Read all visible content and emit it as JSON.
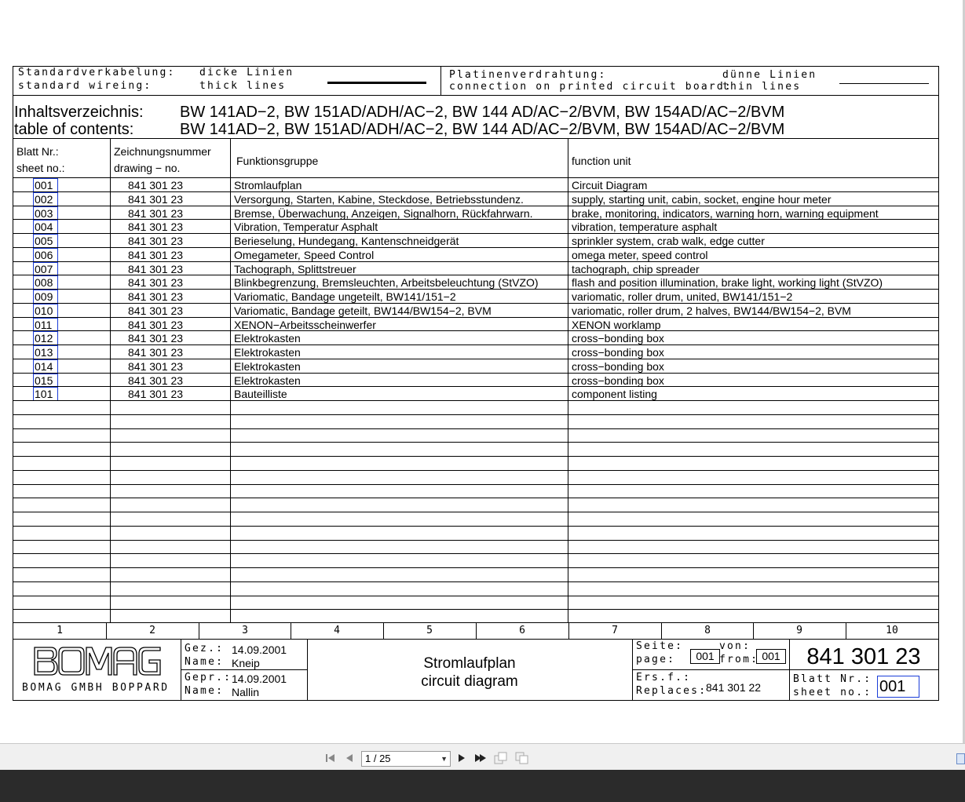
{
  "legend": {
    "std_de": "Standardverkabelung:",
    "std_en": "standard wireing:",
    "thick_de": "dicke Linien",
    "thick_en": "thick lines",
    "pcb_de": "Platinenverdrahtung:",
    "pcb_en": "connection on printed circuit board:",
    "thin_de": "dünne Linien",
    "thin_en": "thin lines"
  },
  "toc": {
    "label_de": "Inhaltsverzeichnis:",
    "label_en": "table of contents:",
    "models_de": "BW 141AD−2, BW 151AD/ADH/AC−2, BW 144 AD/AC−2/BVM, BW 154AD/AC−2/BVM",
    "models_en": "BW 141AD−2, BW 151AD/ADH/AC−2, BW 144 AD/AC−2/BVM, BW 154AD/AC−2/BVM"
  },
  "table": {
    "headers": {
      "sheet_de": "Blatt Nr.:",
      "sheet_en": "sheet no.:",
      "drawing_de": "Zeichnungsnummer",
      "drawing_en": "drawing − no.",
      "func_de": "Funktionsgruppe",
      "func_en": "function unit"
    },
    "rows": [
      {
        "sheet": "001",
        "drawing": "841 301 23",
        "de": "Stromlaufplan",
        "en": "Circuit Diagram"
      },
      {
        "sheet": "002",
        "drawing": "841 301 23",
        "de": "Versorgung, Starten, Kabine, Steckdose, Betriebsstundenz.",
        "en": "supply, starting unit, cabin, socket, engine hour meter"
      },
      {
        "sheet": "003",
        "drawing": "841 301 23",
        "de": "Bremse, Überwachung, Anzeigen, Signalhorn, Rückfahrwarn.",
        "en": "brake, monitoring, indicators, warning horn, warning equipment"
      },
      {
        "sheet": "004",
        "drawing": "841 301 23",
        "de": "Vibration, Temperatur Asphalt",
        "en": "vibration, temperature asphalt"
      },
      {
        "sheet": "005",
        "drawing": "841 301 23",
        "de": "Berieselung, Hundegang, Kantenschneidgerät",
        "en": "sprinkler system, crab walk, edge cutter"
      },
      {
        "sheet": "006",
        "drawing": "841 301 23",
        "de": "Omegameter, Speed Control",
        "en": "omega meter, speed control"
      },
      {
        "sheet": "007",
        "drawing": "841 301 23",
        "de": "Tachograph, Splittstreuer",
        "en": "tachograph, chip spreader"
      },
      {
        "sheet": "008",
        "drawing": "841 301 23",
        "de": "Blinkbegrenzung, Bremsleuchten, Arbeitsbeleuchtung (StVZO)",
        "en": "flash and position illumination, brake light, working light (StVZO)"
      },
      {
        "sheet": "009",
        "drawing": "841 301 23",
        "de": "Variomatic, Bandage ungeteilt, BW141/151−2",
        "en": "variomatic, roller drum, united, BW141/151−2"
      },
      {
        "sheet": "010",
        "drawing": "841 301 23",
        "de": "Variomatic, Bandage geteilt, BW144/BW154−2,  BVM",
        "en": "variomatic, roller drum, 2 halves, BW144/BW154−2,  BVM"
      },
      {
        "sheet": "011",
        "drawing": "841 301 23",
        "de": "XENON−Arbeitsscheinwerfer",
        "en": "XENON worklamp"
      },
      {
        "sheet": "012",
        "drawing": "841 301 23",
        "de": "Elektrokasten",
        "en": "cross−bonding box"
      },
      {
        "sheet": "013",
        "drawing": "841 301 23",
        "de": "Elektrokasten",
        "en": "cross−bonding box"
      },
      {
        "sheet": "014",
        "drawing": "841 301 23",
        "de": "Elektrokasten",
        "en": "cross−bonding box"
      },
      {
        "sheet": "015",
        "drawing": "841 301 23",
        "de": "Elektrokasten",
        "en": "cross−bonding box"
      },
      {
        "sheet": "101",
        "drawing": "841 301 23",
        "de": "Bauteilliste",
        "en": "component listing"
      }
    ]
  },
  "columns": [
    "1",
    "2",
    "3",
    "4",
    "5",
    "6",
    "7",
    "8",
    "9",
    "10"
  ],
  "title_block": {
    "logo": "BOMAG",
    "company": "BOMAG GMBH BOPPARD",
    "gez_label": "Gez.:",
    "gez_date": "14.09.2001",
    "name_label1": "Name:",
    "name1": "Kneip",
    "gepr_label": "Gepr.:",
    "gepr_date": "14.09.2001",
    "name_label2": "Name:",
    "name2": "Nallin",
    "title_de": "Stromlaufplan",
    "title_en": "circuit diagram",
    "seite_label": "Seite:",
    "page_label": "page:",
    "page_value": "001",
    "von_label": "von:",
    "from_label": "from:",
    "from_value": "001",
    "drawing_number": "841 301 23",
    "ersf_label": "Ers.f.:",
    "replaces_label": "Replaces:",
    "replaces_value": "841 301 22",
    "blatt_label": "Blatt Nr.:",
    "sheet_label": "sheet no.:",
    "sheet_value": "001"
  },
  "viewer": {
    "page_indicator": "1 / 25",
    "icons": [
      "first-page-icon",
      "prev-page-icon",
      "next-page-icon",
      "last-page-icon",
      "copy-icon",
      "paste-icon"
    ]
  }
}
